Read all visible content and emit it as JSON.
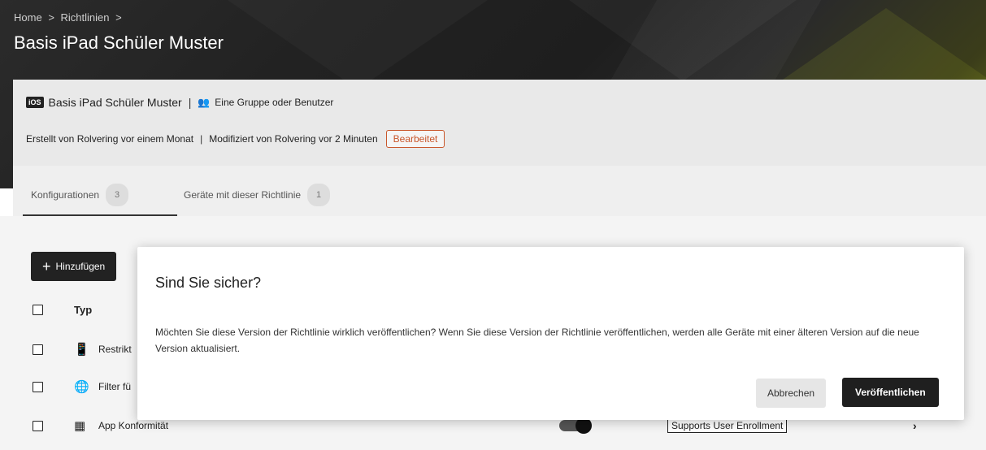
{
  "header": {
    "breadcrumb": [
      "Home",
      ">",
      "Richtlinien",
      ">"
    ],
    "title": "Basis iPad Schüler Muster"
  },
  "info": {
    "platform_badge": "iOS",
    "policy_name": "Basis iPad Schüler Muster",
    "separator": "|",
    "assignment_icon": "group-icon",
    "assignment_text": "Eine Gruppe oder Benutzer",
    "created_text": "Erstellt von Rolvering vor einem Monat",
    "modified_text": "Modifiziert von Rolvering vor 2 Minuten",
    "status_badge": "Bearbeitet"
  },
  "tabs": [
    {
      "label": "Konfigurationen",
      "count": "3",
      "active": true
    },
    {
      "label": "Geräte mit dieser Richtlinie",
      "count": "1",
      "active": false
    }
  ],
  "toolbar": {
    "add_label": "Hinzufügen"
  },
  "table": {
    "header_type": "Typ",
    "rows": [
      {
        "icon": "restriction-icon",
        "label": "Restrikt"
      },
      {
        "icon": "web-filter-icon",
        "label": "Filter fü"
      },
      {
        "icon": "app-grid-icon",
        "label": "App Konformität",
        "badge": "Supports User Enrollment"
      }
    ]
  },
  "modal": {
    "title": "Sind Sie sicher?",
    "body": "Möchten Sie diese Version der Richtlinie wirklich veröffentlichen? Wenn Sie diese Version der Richtlinie veröffentlichen, werden alle Geräte mit einer älteren Version auf die neue Version aktualisiert.",
    "cancel_label": "Abbrechen",
    "confirm_label": "Veröffentlichen"
  }
}
